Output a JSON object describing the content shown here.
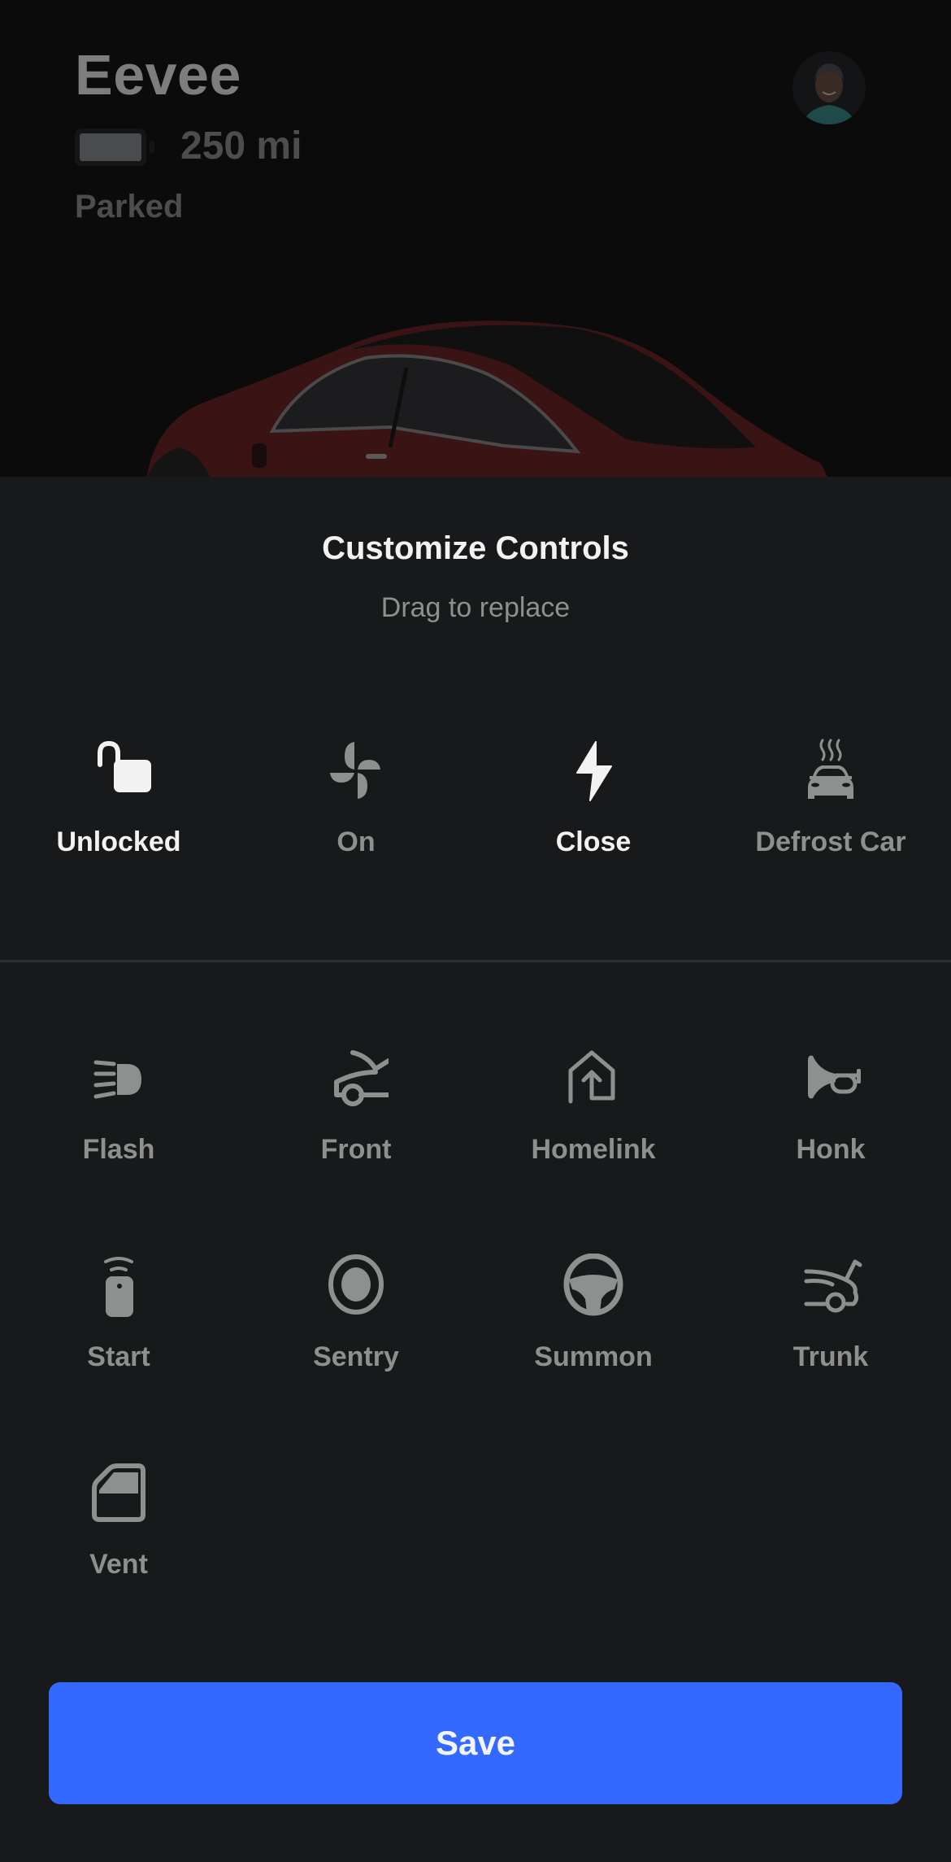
{
  "vehicle": {
    "name": "Eevee",
    "range": "250 mi",
    "status": "Parked",
    "battery_level": 0.85
  },
  "profile": {
    "avatar_alt": "User avatar"
  },
  "sheet": {
    "title": "Customize Controls",
    "subtitle": "Drag to replace"
  },
  "active_controls": [
    {
      "label": "Unlocked",
      "icon": "unlock-icon",
      "state": "active"
    },
    {
      "label": "On",
      "icon": "fan-icon",
      "state": "inactive"
    },
    {
      "label": "Close",
      "icon": "bolt-icon",
      "state": "active"
    },
    {
      "label": "Defrost Car",
      "icon": "defrost-car-icon",
      "state": "inactive"
    }
  ],
  "available_controls": [
    {
      "label": "Flash",
      "icon": "headlight-icon"
    },
    {
      "label": "Front",
      "icon": "frunk-icon"
    },
    {
      "label": "Homelink",
      "icon": "homelink-icon"
    },
    {
      "label": "Honk",
      "icon": "horn-icon"
    },
    {
      "label": "Start",
      "icon": "remote-start-icon"
    },
    {
      "label": "Sentry",
      "icon": "sentry-icon"
    },
    {
      "label": "Summon",
      "icon": "steering-wheel-icon"
    },
    {
      "label": "Trunk",
      "icon": "trunk-icon"
    },
    {
      "label": "Vent",
      "icon": "window-vent-icon"
    }
  ],
  "actions": {
    "save_label": "Save"
  },
  "colors": {
    "accent": "#3469ff",
    "active": "#f2f2f2",
    "inactive": "#8e9090",
    "sheet_bg": "#18191b",
    "hero_bg": "#0b0b0c",
    "car_paint": "#5a1c1c"
  }
}
